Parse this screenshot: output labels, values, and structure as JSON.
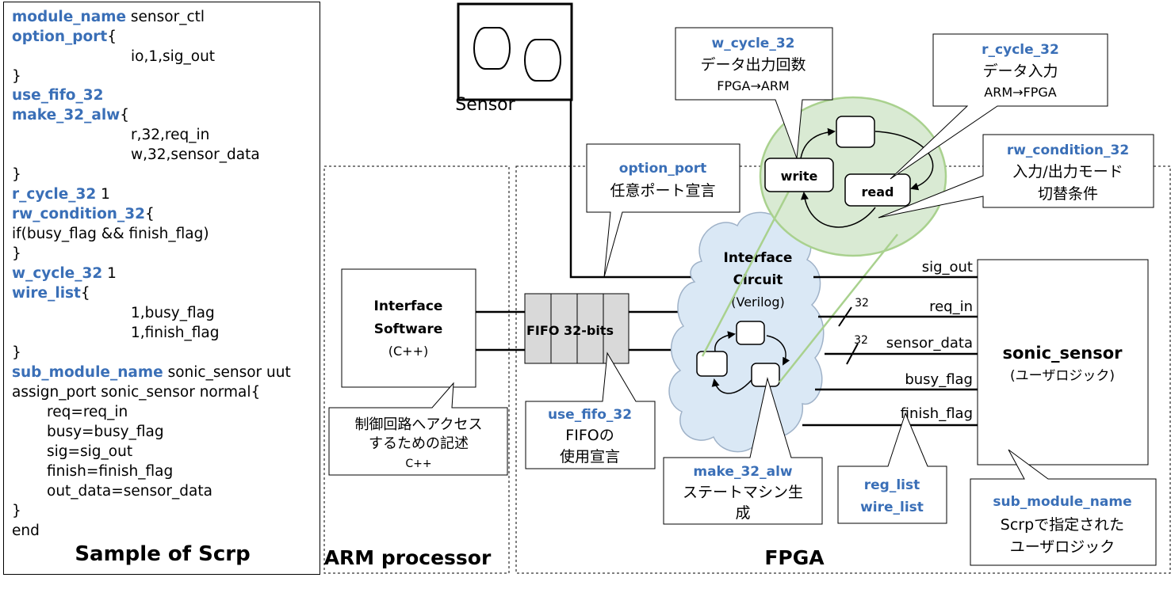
{
  "code_panel": {
    "title": "Sample of Scrp",
    "lines": [
      {
        "kw": "module_name",
        "text": " sensor_ctl"
      },
      {
        "kw": "option_port",
        "text": "{"
      },
      {
        "kw": "",
        "text": "io,1,sig_out"
      },
      {
        "kw": "",
        "text": "}"
      },
      {
        "kw": "use_fifo_32",
        "text": ""
      },
      {
        "kw": "make_32_alw",
        "text": "{"
      },
      {
        "kw": "",
        "text": "r,32,req_in"
      },
      {
        "kw": "",
        "text": "w,32,sensor_data"
      },
      {
        "kw": "",
        "text": "}"
      },
      {
        "kw": "r_cycle_32",
        "text": " 1"
      },
      {
        "kw": "rw_condition_32",
        "text": "{"
      },
      {
        "kw": "",
        "text": "if(busy_flag && finish_flag)"
      },
      {
        "kw": "",
        "text": "}"
      },
      {
        "kw": "w_cycle_32",
        "text": " 1"
      },
      {
        "kw": "wire_list",
        "text": "{"
      },
      {
        "kw": "",
        "text": "1,busy_flag"
      },
      {
        "kw": "",
        "text": "1,finish_flag"
      },
      {
        "kw": "",
        "text": "}"
      },
      {
        "kw": "sub_module_name",
        "text": " sonic_sensor uut"
      },
      {
        "kw": "",
        "text": "assign_port sonic_sensor normal{"
      },
      {
        "kw": "",
        "text": "req=req_in"
      },
      {
        "kw": "",
        "text": "busy=busy_flag"
      },
      {
        "kw": "",
        "text": "sig=sig_out"
      },
      {
        "kw": "",
        "text": "finish=finish_flag"
      },
      {
        "kw": "",
        "text": "out_data=sensor_data"
      },
      {
        "kw": "",
        "text": "}"
      },
      {
        "kw": "",
        "text": "end"
      }
    ]
  },
  "labels": {
    "sensor": "Sensor",
    "arm_processor": "ARM processor",
    "fpga": "FPGA",
    "interface_software_1": "Interface",
    "interface_software_2": "Software",
    "interface_software_3": "(C++)",
    "fifo": "FIFO 32-bits",
    "interface_circuit_1": "Interface",
    "interface_circuit_2": "Circuit",
    "interface_circuit_3": "(Verilog)",
    "write": "write",
    "read": "read",
    "sonic_sensor": "sonic_sensor",
    "sonic_sensor_sub": "(ユーザロジック)",
    "bus_width_1": "32",
    "bus_width_2": "32"
  },
  "signals": [
    "sig_out",
    "req_in",
    "sensor_data",
    "busy_flag",
    "finish_flag"
  ],
  "callouts": {
    "w_cycle": {
      "kw": "w_cycle_32",
      "l1": "データ出力回数",
      "l2": "FPGA→ARM"
    },
    "r_cycle": {
      "kw": "r_cycle_32",
      "l1": "データ入力",
      "l2": "ARM→FPGA"
    },
    "rw_condition": {
      "kw": "rw_condition_32",
      "l1": "入力/出力モード",
      "l2": "切替条件"
    },
    "option_port": {
      "kw": "option_port",
      "l1": "任意ポート宣言"
    },
    "software": {
      "l1": "制御回路へアクセス",
      "l2": "するための記述",
      "l3": "C++"
    },
    "use_fifo": {
      "kw": "use_fifo_32",
      "l1": "FIFOの",
      "l2": "使用宣言"
    },
    "make_alw": {
      "kw": "make_32_alw",
      "l1": "ステートマシン生",
      "l2": "成"
    },
    "reg_list": {
      "kw1": "reg_list",
      "kw2": "wire_list"
    },
    "sub_module": {
      "kw": "sub_module_name",
      "l1": "Scrpで指定された",
      "l2": "ユーザロジック"
    }
  },
  "colors": {
    "keyword": "#3a6fb7",
    "fifo_fill": "#d9d9d9",
    "cloud_fill": "#dae8f5",
    "cloud_stroke": "#9fb2c8",
    "fsm_fill": "#d9ead3",
    "fsm_stroke": "#a9d18e"
  }
}
